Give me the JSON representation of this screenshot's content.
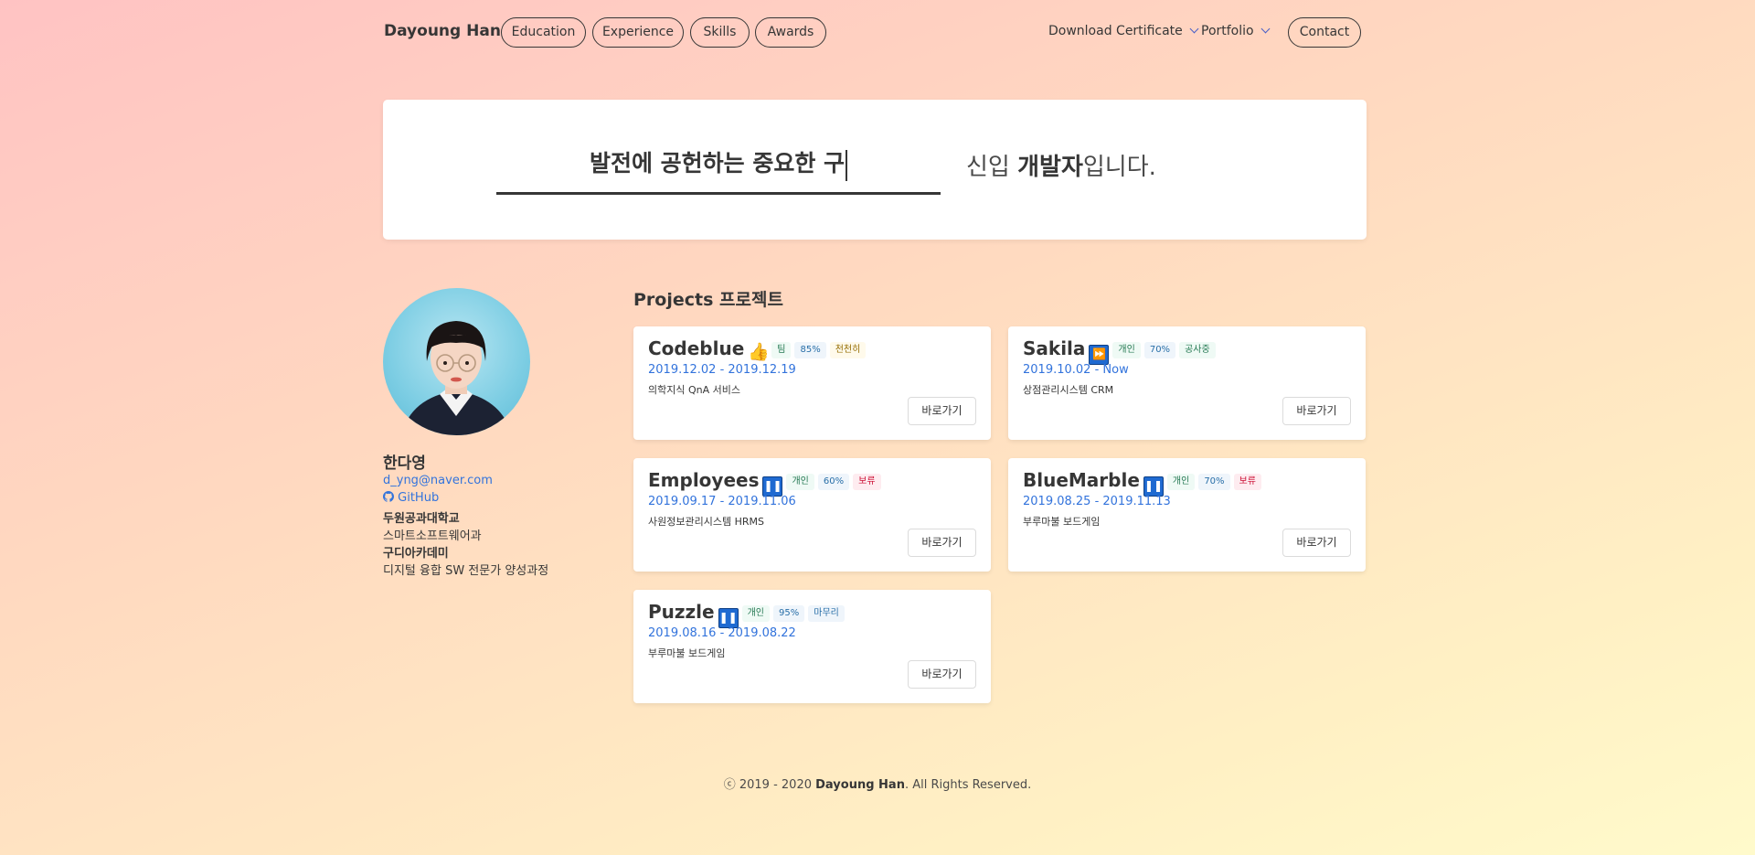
{
  "nav": {
    "brand": "Dayoung Han",
    "items": [
      "Education",
      "Experience",
      "Skills",
      "Awards"
    ],
    "download": "Download Certificate",
    "portfolio": "Portfolio",
    "contact": "Contact"
  },
  "hero": {
    "typed": "발전에 공헌하는 중요한 구",
    "rest_plain1": "신입 ",
    "rest_bold": "개발자",
    "rest_plain2": "입니다."
  },
  "profile": {
    "name": "한다영",
    "email": "d_yng@naver.com",
    "github": "GitHub",
    "school": "두원공과대학교",
    "major": "스마트소프트웨어과",
    "academy": "구디아카데미",
    "course": "디지털 융합 SW 전문가 양성과정"
  },
  "projects": {
    "title": "Projects 프로젝트",
    "button_label": "바로가기",
    "items": [
      {
        "name": "Codeblue",
        "icon": "thumbs-up-icon",
        "tags": [
          "팀",
          "85%",
          "천천히"
        ],
        "date": "2019.12.02 - 2019.12.19",
        "desc": "의학지식 QnA 서비스"
      },
      {
        "name": "Sakila",
        "icon": "fast-forward-icon",
        "tags": [
          "개인",
          "70%",
          "공사중"
        ],
        "date": "2019.10.02 - Now",
        "desc": "상점관리시스템 CRM"
      },
      {
        "name": "Employees",
        "icon": "pause-icon",
        "tags": [
          "개인",
          "60%",
          "보류"
        ],
        "date": "2019.09.17 - 2019.11.06",
        "desc": "사원정보관리시스템 HRMS"
      },
      {
        "name": "BlueMarble",
        "icon": "pause-icon",
        "tags": [
          "개인",
          "70%",
          "보류"
        ],
        "date": "2019.08.25 - 2019.11.13",
        "desc": "부루마불 보드게임"
      },
      {
        "name": "Puzzle",
        "icon": "pause-icon",
        "tags": [
          "개인",
          "95%",
          "마무리"
        ],
        "date": "2019.08.16 - 2019.08.22",
        "desc": "부루마불 보드게임"
      }
    ]
  },
  "footer": {
    "pre": "ⓒ 2019 - 2020 ",
    "name": "Dayoung Han",
    "post": ". All Rights Reserved."
  },
  "colors": {
    "link": "#3273dc",
    "pause_icon": "#1f6ad1",
    "text": "#363636"
  }
}
